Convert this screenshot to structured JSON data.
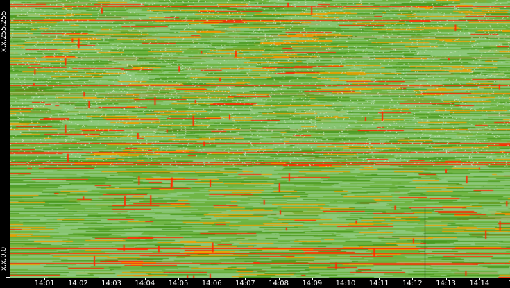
{
  "chart_data": {
    "type": "heatmap",
    "title": "",
    "xlabel": "",
    "ylabel": "",
    "y_labels": {
      "top": "x.x.255.255",
      "bottom": "x.x.0.0"
    },
    "x_ticks": [
      "14:01",
      "14:02",
      "14:03",
      "14:04",
      "14:05",
      "14:06",
      "14:07",
      "14:08",
      "14:09",
      "14:10",
      "14:11",
      "14:12",
      "14:13",
      "14:14",
      "14"
    ],
    "x_range_minutes": [
      0,
      14.95
    ],
    "colors": {
      "low": "#8cc87a",
      "mid_low": "#6db33f",
      "mid": "#4a9a20",
      "high": "#f0a000",
      "peak": "#ff2a00",
      "sparse": "#e8f0e0",
      "dark": "#1a3a10",
      "background": "#000000"
    }
  }
}
